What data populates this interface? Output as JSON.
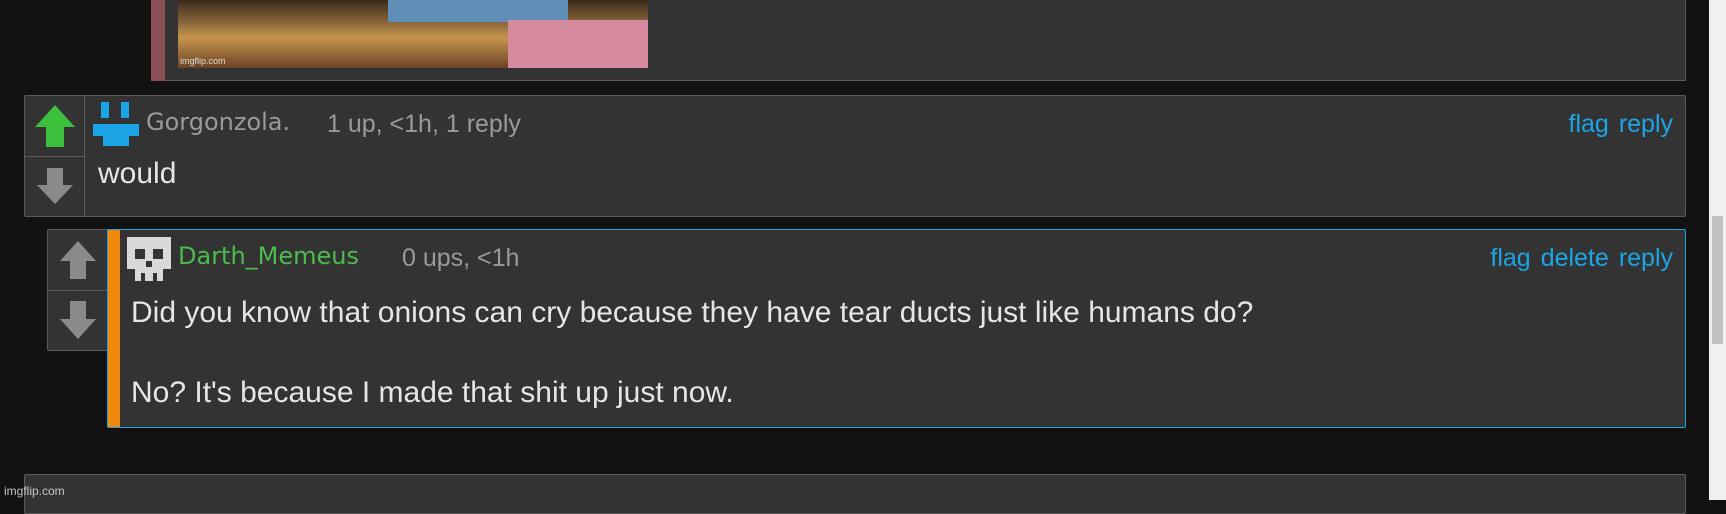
{
  "previous_comment": {
    "image_watermark": "imgflip.com"
  },
  "comment_1": {
    "username": "Gorgonzola.",
    "meta": "1 up, <1h, 1 reply",
    "body": "would",
    "actions": [
      "flag",
      "reply"
    ],
    "username_color": "#9a9a9a",
    "upvoted": true
  },
  "comment_2": {
    "username": "Darth_Memeus",
    "meta": "0 ups, <1h",
    "body": "Did you know that onions can cry because they have tear ducts just like humans do?\n\nNo? It's because I made that shit up just now.",
    "actions": [
      "flag",
      "delete",
      "reply"
    ],
    "username_color": "#4cbb4c",
    "highlight_bar_color": "#f08a0c",
    "border_color": "#1ba5e6"
  },
  "footer": {
    "watermark": "imgflip.com"
  },
  "colors": {
    "page_bg": "#121212",
    "card_bg": "#333333",
    "link": "#1ba5e6",
    "upvote_active": "#3cbf3c",
    "vote_inactive": "#8a8a8a"
  }
}
